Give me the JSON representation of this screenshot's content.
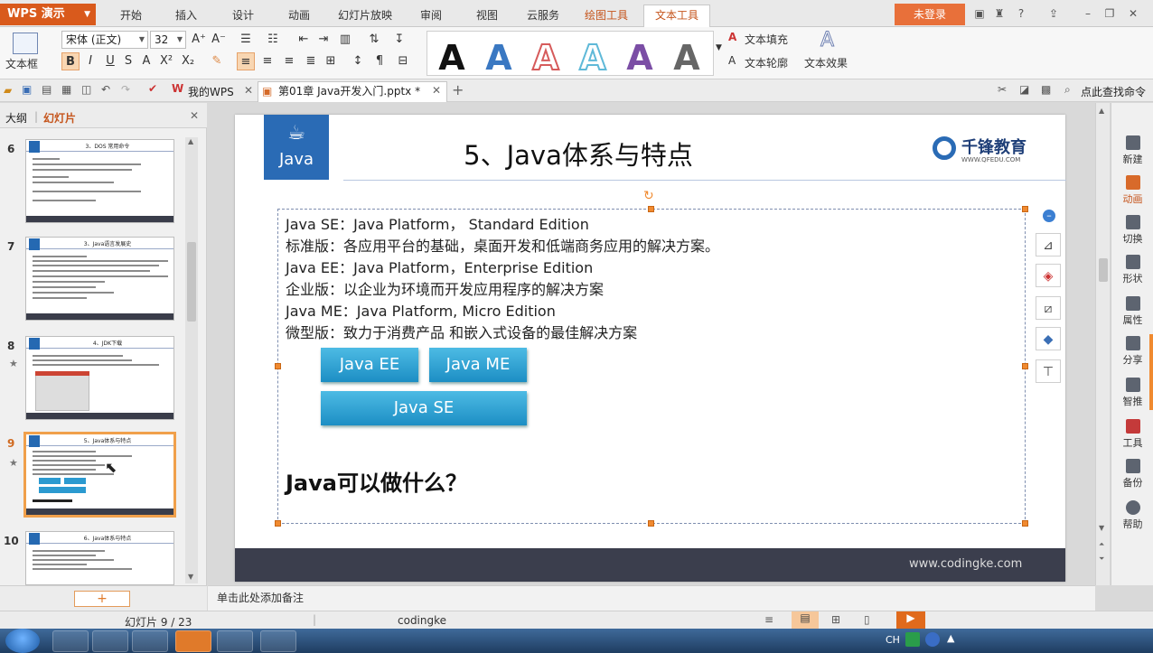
{
  "app": {
    "menu_button": "WPS 演示",
    "tabs": [
      "开始",
      "插入",
      "设计",
      "动画",
      "幻灯片放映",
      "审阅",
      "视图",
      "云服务",
      "绘图工具",
      "文本工具"
    ],
    "login": "未登录"
  },
  "ribbon": {
    "textbox": "文本框",
    "font_name": "宋体 (正文)",
    "font_size": "32",
    "grow": "A⁺",
    "shrink": "A⁻",
    "bold": "B",
    "italic": "I",
    "underline": "U",
    "strike": "S",
    "text_fill": "文本填充",
    "text_outline": "文本轮廓",
    "text_effect": "文本效果",
    "style_letter": "A"
  },
  "tabbar": {
    "my_wps": "我的WPS",
    "doc_tab": "第01章 Java开发入门.pptx *",
    "find": "点此查找命令"
  },
  "left_panel": {
    "tab_outline": "大纲",
    "tab_slides": "幻灯片",
    "thumbs": [
      {
        "num": "6",
        "title": "3、DOS 常用命令"
      },
      {
        "num": "7",
        "title": "3、Java语言发展史"
      },
      {
        "num": "8",
        "title": "4、JDK下载"
      },
      {
        "num": "9",
        "title": "5、Java体系与特点"
      },
      {
        "num": "10",
        "title": "6、Java体系与特点"
      }
    ],
    "add_slide": "+"
  },
  "slide": {
    "logo_text": "Java",
    "title": "5、Java体系与特点",
    "brand": "千锋教育",
    "brand_url": "WWW.QFEDU.COM",
    "lines": [
      "Java SE：Java Platform， Standard Edition",
      "标准版：各应用平台的基础，桌面开发和低端商务应用的解决方案。",
      "Java EE：Java Platform，Enterprise Edition",
      "企业版：以企业为环境而开发应用程序的解决方案",
      "Java ME：Java Platform, Micro Edition",
      "微型版：致力于消费产品 和嵌入式设备的最佳解决方案"
    ],
    "btn_ee": "Java EE",
    "btn_me": "Java ME",
    "btn_se": "Java SE",
    "question": "Java可以做什么？",
    "footer_url": "www.codingke.com"
  },
  "right_bar": [
    "新建",
    "动画",
    "切换",
    "形状",
    "属性",
    "分享",
    "智推",
    "工具",
    "备份",
    "帮助"
  ],
  "notes": "单击此处添加备注",
  "status": {
    "slide_count": "幻灯片 9 / 23",
    "theme": "codingke"
  },
  "taskbar": {
    "lang": "CH"
  },
  "colors": {
    "accent": "#d95a1c",
    "java_blue": "#2a6bb5",
    "button_blue": "#1c8ec4",
    "footer": "#3b3e4d"
  }
}
